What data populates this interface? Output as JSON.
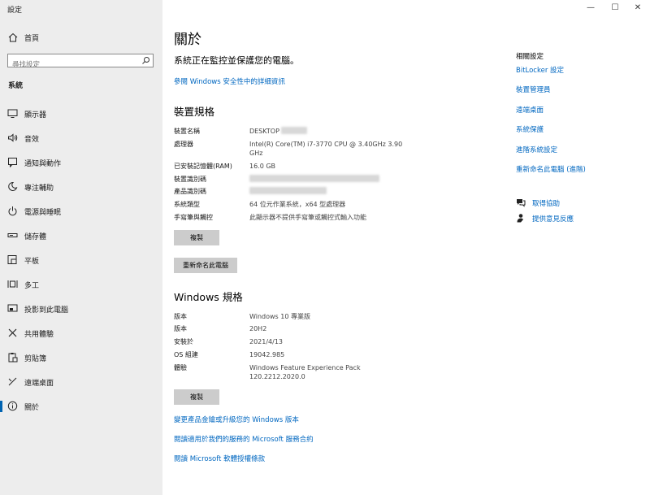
{
  "window": {
    "title": "設定",
    "controls": {
      "minimize": "—",
      "maximize": "☐",
      "close": "✕"
    }
  },
  "sidebar": {
    "home": "首頁",
    "search_placeholder": "尋找設定",
    "section": "系統",
    "items": [
      {
        "label": "顯示器",
        "icon": "monitor-icon"
      },
      {
        "label": "音效",
        "icon": "speaker-icon"
      },
      {
        "label": "通知與動作",
        "icon": "notification-icon"
      },
      {
        "label": "專注輔助",
        "icon": "moon-icon"
      },
      {
        "label": "電源與睡眠",
        "icon": "power-icon"
      },
      {
        "label": "儲存體",
        "icon": "storage-icon"
      },
      {
        "label": "平板",
        "icon": "tablet-icon"
      },
      {
        "label": "多工",
        "icon": "multitask-icon"
      },
      {
        "label": "投影到此電腦",
        "icon": "project-icon"
      },
      {
        "label": "共用體驗",
        "icon": "share-icon"
      },
      {
        "label": "剪貼簿",
        "icon": "clipboard-icon"
      },
      {
        "label": "遠端桌面",
        "icon": "remote-icon"
      },
      {
        "label": "關於",
        "icon": "info-icon"
      }
    ],
    "active_index": 12
  },
  "main": {
    "title": "關於",
    "monitor_text": "系統正在監控並保護您的電腦。",
    "security_link": "參閱 Windows 安全性中的詳細資訊",
    "device_specs": {
      "heading": "裝置規格",
      "rows": [
        {
          "key": "裝置名稱",
          "value": "DESKTOP"
        },
        {
          "key": "處理器",
          "value": "Intel(R) Core(TM) i7-3770 CPU @ 3.40GHz   3.90 GHz"
        },
        {
          "key": "已安裝記憶體(RAM)",
          "value": "16.0 GB"
        },
        {
          "key": "裝置識別碼",
          "value": ""
        },
        {
          "key": "產品識別碼",
          "value": ""
        },
        {
          "key": "系統類型",
          "value": "64 位元作業系統，x64 型處理器"
        },
        {
          "key": "手寫筆與觸控",
          "value": "此顯示器不提供手寫筆或觸控式輸入功能"
        }
      ],
      "copy_button": "複製",
      "rename_button": "重新命名此電腦"
    },
    "windows_specs": {
      "heading": "Windows 規格",
      "rows": [
        {
          "key": "版本",
          "value": "Windows 10 專業版"
        },
        {
          "key": "版本",
          "value": "20H2"
        },
        {
          "key": "安裝於",
          "value": "2021/4/13"
        },
        {
          "key": "OS 組建",
          "value": "19042.985"
        },
        {
          "key": "體驗",
          "value": "Windows Feature Experience Pack 120.2212.2020.0"
        }
      ],
      "copy_button": "複製"
    },
    "bottom_links": [
      "變更產品金鑰或升級您的 Windows 版本",
      "閱讀適用於我們的服務的 Microsoft 服務合約",
      "閱讀 Microsoft 軟體授權條款"
    ]
  },
  "related": {
    "heading": "相關設定",
    "links": [
      "BitLocker 設定",
      "裝置管理員",
      "遠端桌面",
      "系統保護",
      "進階系統設定",
      "重新命名此電腦 (進階)"
    ],
    "help": {
      "label": "取得協助",
      "icon": "help-chat-icon"
    },
    "feedback": {
      "label": "提供意見反應",
      "icon": "feedback-icon"
    }
  },
  "colors": {
    "accent": "#0067c0",
    "sidebar_bg": "#ededed",
    "button_bg": "#cccccc"
  }
}
